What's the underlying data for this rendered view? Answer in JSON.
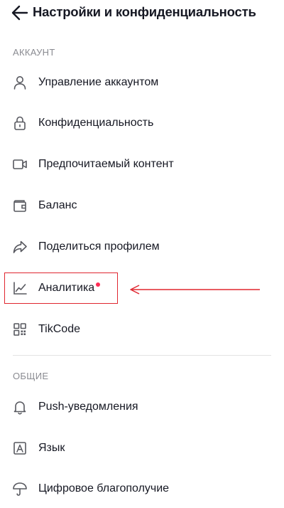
{
  "header": {
    "title": "Настройки и конфиденциальность"
  },
  "sections": {
    "account_title": "АККАУНТ",
    "general_title": "ОБЩИЕ"
  },
  "account_items": [
    {
      "label": "Управление аккаунтом",
      "icon": "person-icon"
    },
    {
      "label": "Конфиденциальность",
      "icon": "lock-icon"
    },
    {
      "label": "Предпочитаемый контент",
      "icon": "video-camera-icon"
    },
    {
      "label": "Баланс",
      "icon": "wallet-icon"
    },
    {
      "label": "Поделиться профилем",
      "icon": "share-arrow-icon"
    },
    {
      "label": "Аналитика",
      "icon": "line-chart-icon",
      "has_notification_dot": true
    },
    {
      "label": "TikCode",
      "icon": "qr-code-icon"
    }
  ],
  "general_items": [
    {
      "label": "Push-уведомления",
      "icon": "bell-icon"
    },
    {
      "label": "Язык",
      "icon": "language-icon"
    },
    {
      "label": "Цифровое благополучие",
      "icon": "umbrella-icon"
    }
  ],
  "colors": {
    "text": "#161823",
    "section_text": "#8a8b91",
    "notification_dot": "#fe2c55",
    "annotation_red": "#e0262f"
  }
}
